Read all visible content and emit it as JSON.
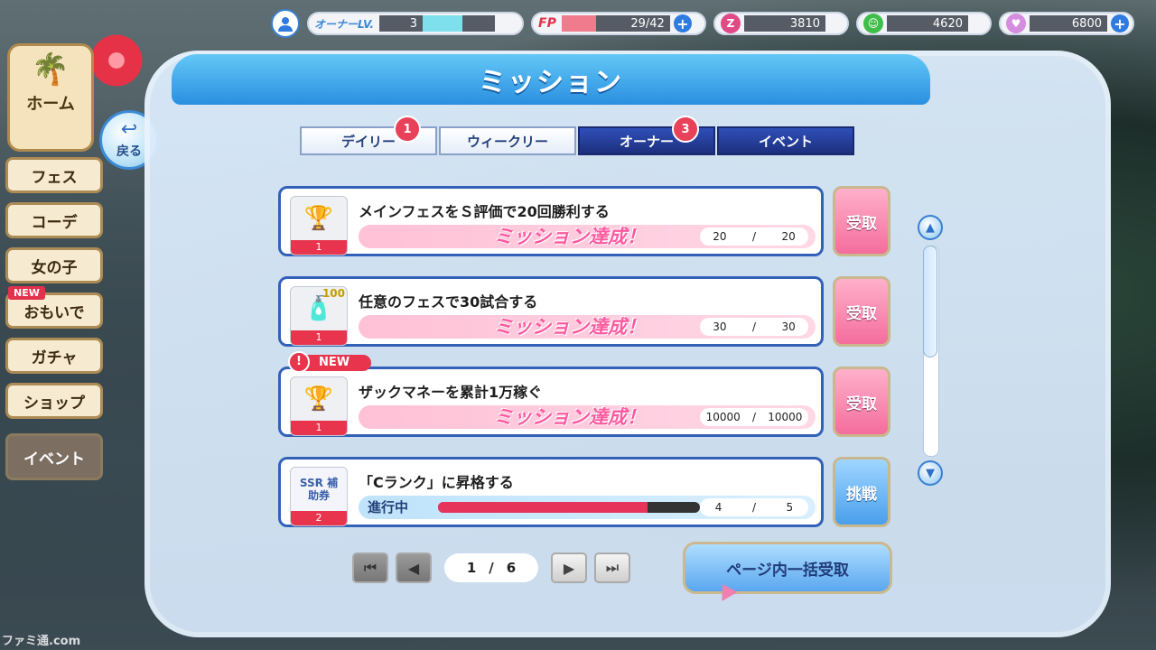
{
  "topbar": {
    "owner_label": "オーナーLV.",
    "owner_level": "3",
    "owner_gauge": 0.55,
    "fp_label": "FP",
    "fp_value": "29/42",
    "fp_gauge": 0.69,
    "currency_a": "3810",
    "currency_b": "4620",
    "currency_c": "6800",
    "plus": "+"
  },
  "side": {
    "home": "ホーム",
    "back": "戻る",
    "items": [
      {
        "label": "フェス"
      },
      {
        "label": "コーデ"
      },
      {
        "label": "女の子"
      },
      {
        "label": "おもいで",
        "new": "NEW"
      },
      {
        "label": "ガチャ"
      },
      {
        "label": "ショップ"
      },
      {
        "label": "イベント"
      }
    ]
  },
  "panel": {
    "title": "ミッション",
    "tabs": [
      {
        "label": "デイリー",
        "badge": "1"
      },
      {
        "label": "ウィークリー"
      },
      {
        "label": "オーナー",
        "badge": "3"
      },
      {
        "label": "イベント"
      }
    ]
  },
  "missions": [
    {
      "title": "メインフェスをＳ評価で20回勝利する",
      "reward_count": "1",
      "reward_icon": "trophy-icon",
      "status": "ミッション達成！",
      "current": "20",
      "total": "20",
      "sep": "/",
      "action": "受取"
    },
    {
      "title": "任意のフェスで30試合する",
      "reward_count": "1",
      "reward_icon": "drink-bottle-icon",
      "reward_tag": "100",
      "status": "ミッション達成！",
      "current": "30",
      "total": "30",
      "sep": "/",
      "action": "受取"
    },
    {
      "title": "ザックマネーを累計1万稼ぐ",
      "reward_count": "1",
      "reward_icon": "trophy-icon",
      "new": "NEW",
      "status": "ミッション達成！",
      "current": "10000",
      "total": "10000",
      "sep": "/",
      "action": "受取"
    },
    {
      "title": "「Cランク」に昇格する",
      "reward_count": "2",
      "reward_icon": "ssr-ticket-icon",
      "reward_text": "SSR 補助券",
      "status": "進行中",
      "progress": 0.8,
      "current": "4",
      "total": "5",
      "sep": "/",
      "action": "挑戦"
    }
  ],
  "pager": {
    "current": "1",
    "sep": "/",
    "total": "6"
  },
  "bulk_button": "ページ内一括受取",
  "watermark": "ファミ通.com",
  "colors": {
    "accent": "#2a8fe0",
    "achieved": "#ff5aa0",
    "badge": "#e7425a"
  }
}
